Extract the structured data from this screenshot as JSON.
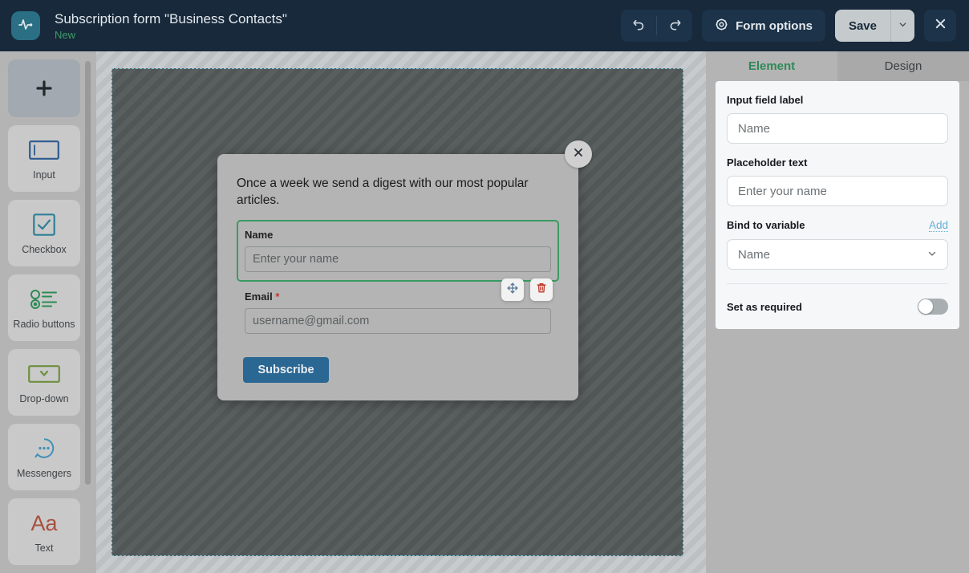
{
  "header": {
    "logo_icon": "pulse-icon",
    "title": "Subscription form \"Business Contacts\"",
    "status": "New",
    "undo_icon": "undo-icon",
    "redo_icon": "redo-icon",
    "form_options_label": "Form options",
    "form_options_icon": "gear-icon",
    "save_label": "Save",
    "save_caret_icon": "chevron-down-icon",
    "close_icon": "close-icon",
    "bg_color": "#17293a",
    "accent_status_color": "#3f9c6b"
  },
  "sidebar": {
    "add_label": "+",
    "items": [
      {
        "label": "Input",
        "icon": "input-field-icon"
      },
      {
        "label": "Checkbox",
        "icon": "checkbox-icon"
      },
      {
        "label": "Radio buttons",
        "icon": "radio-buttons-icon"
      },
      {
        "label": "Drop-down",
        "icon": "dropdown-icon"
      },
      {
        "label": "Messengers",
        "icon": "chat-bubble-icon"
      },
      {
        "label": "Text",
        "icon": "text-aa-icon"
      }
    ]
  },
  "canvas": {
    "preview": {
      "close_icon": "close-icon",
      "digest_text": "Once a week we send a digest with our most popular articles.",
      "fields": [
        {
          "label": "Name",
          "required_mark": "",
          "placeholder": "Enter your name",
          "selected": true
        },
        {
          "label": "Email",
          "required_mark": "*",
          "placeholder": "username@gmail.com",
          "selected": false
        }
      ],
      "field_tools": {
        "move_icon": "move-arrows-icon",
        "delete_icon": "trash-icon"
      },
      "submit_label": "Subscribe",
      "submit_color": "#2b6793"
    },
    "selection_color": "#3a9a62"
  },
  "panel": {
    "tabs": [
      {
        "label": "Element",
        "active": true
      },
      {
        "label": "Design",
        "active": false
      }
    ],
    "input_field_label_title": "Input field label",
    "input_field_label_value": "Name",
    "placeholder_title": "Placeholder text",
    "placeholder_value": "Enter your name",
    "bind_title": "Bind to variable",
    "bind_add_label": "Add",
    "bind_value": "Name",
    "bind_caret_icon": "chevron-down-icon",
    "required_label": "Set as required",
    "required_toggle_state": "off"
  }
}
